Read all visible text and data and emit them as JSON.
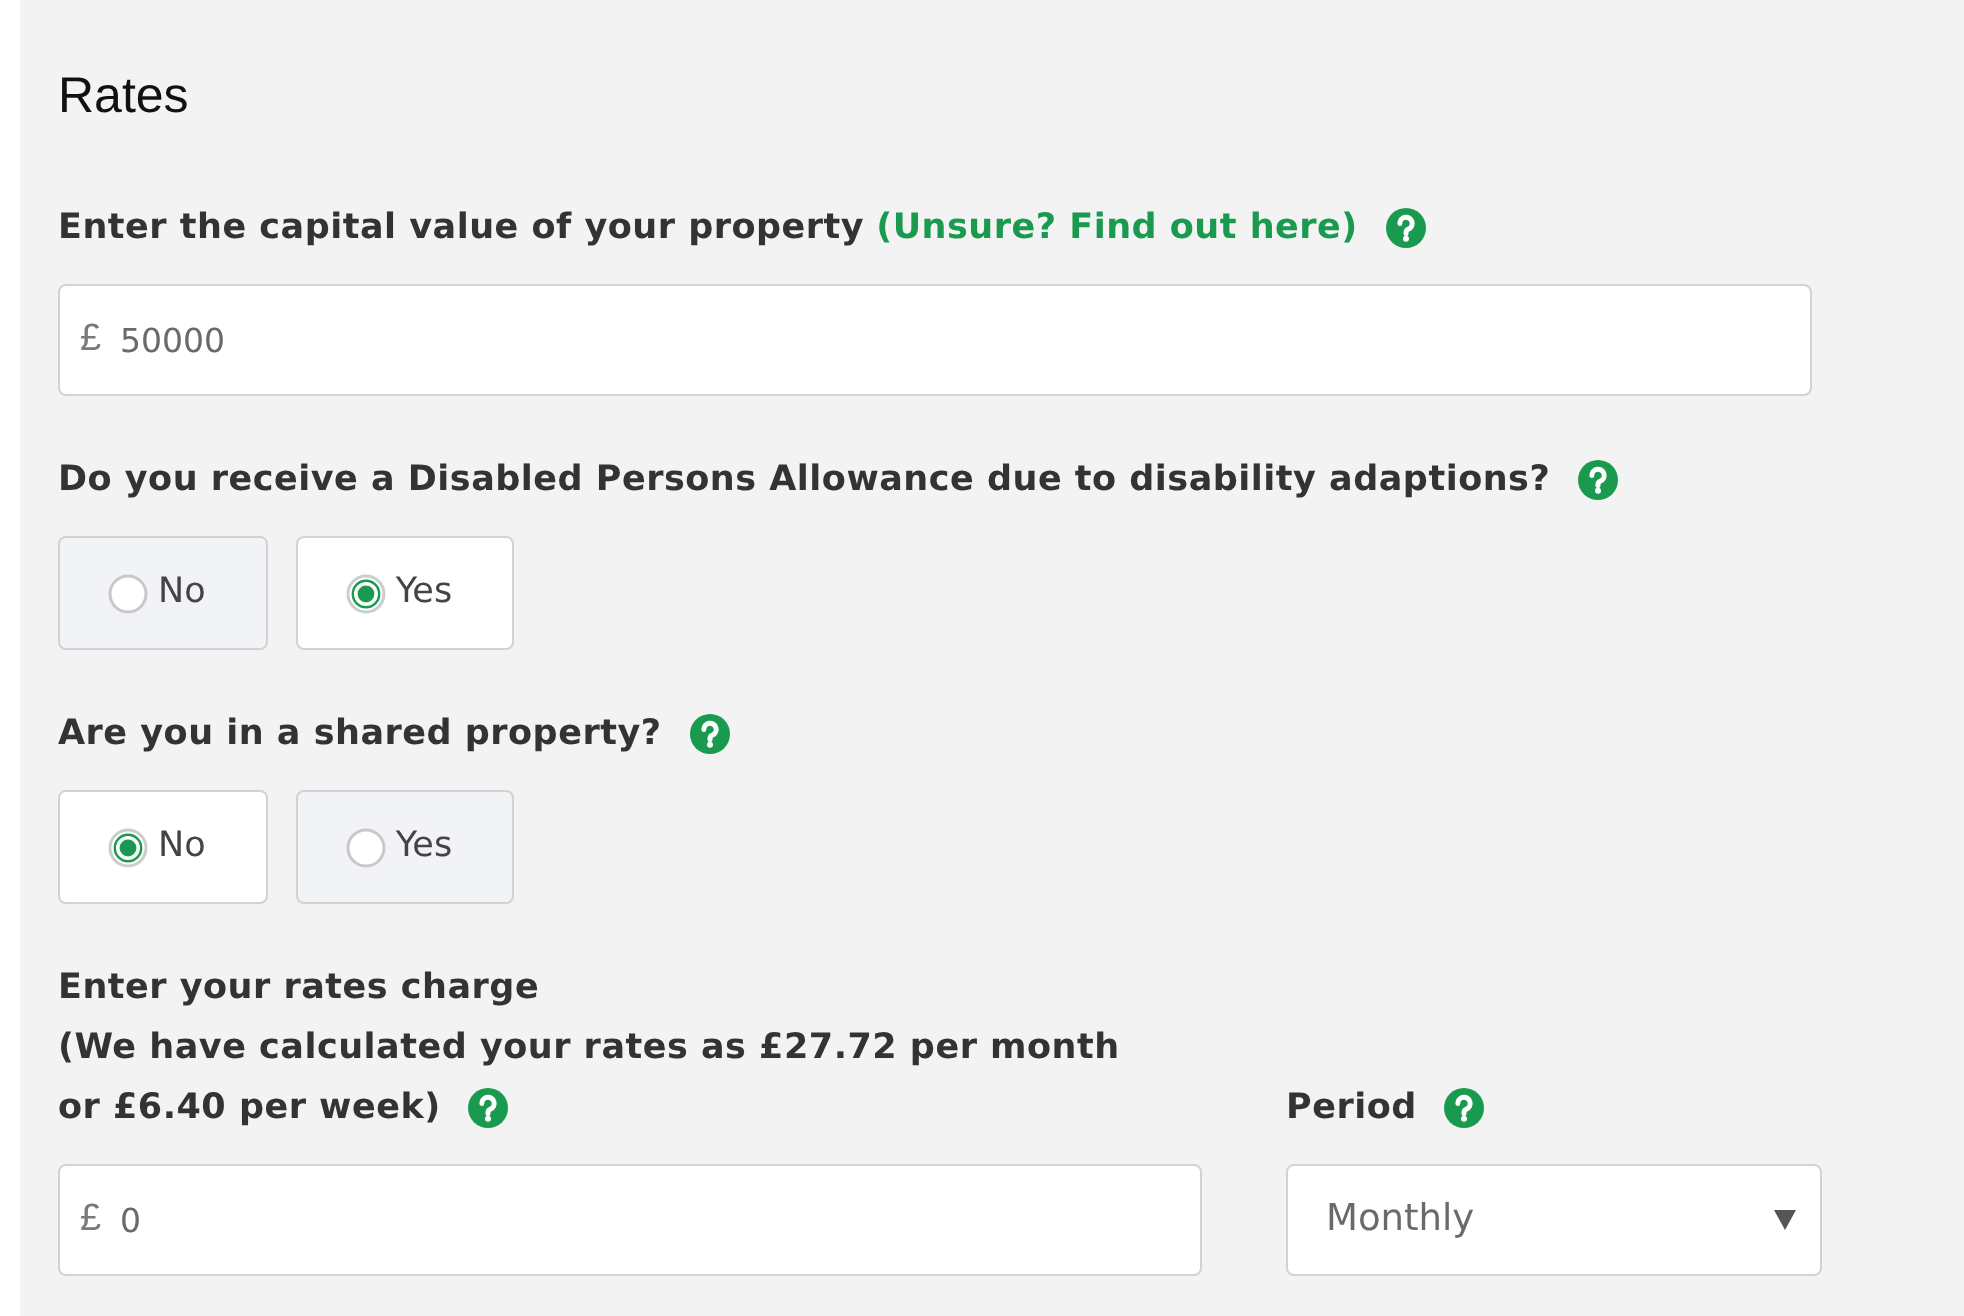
{
  "heading": "Rates",
  "capital_value": {
    "label": "Enter the capital value of your property",
    "link": "(Unsure? Find out here)",
    "currency": "£",
    "value": "50000"
  },
  "questions": [
    {
      "label": "Do you receive a Disabled Persons Allowance due to disability adaptions?",
      "options": [
        {
          "label": "No",
          "selected": false
        },
        {
          "label": "Yes",
          "selected": true
        }
      ]
    },
    {
      "label": "Are you in a shared property?",
      "options": [
        {
          "label": "No",
          "selected": true
        },
        {
          "label": "Yes",
          "selected": false
        }
      ]
    }
  ],
  "rates_charge": {
    "label": "Enter your rates charge",
    "note_lines": [
      "(We have calculated your rates as £27.72 per month",
      "or £6.40 per week)"
    ],
    "currency": "£",
    "value": "0"
  },
  "period": {
    "label": "Period",
    "value": "Monthly"
  }
}
